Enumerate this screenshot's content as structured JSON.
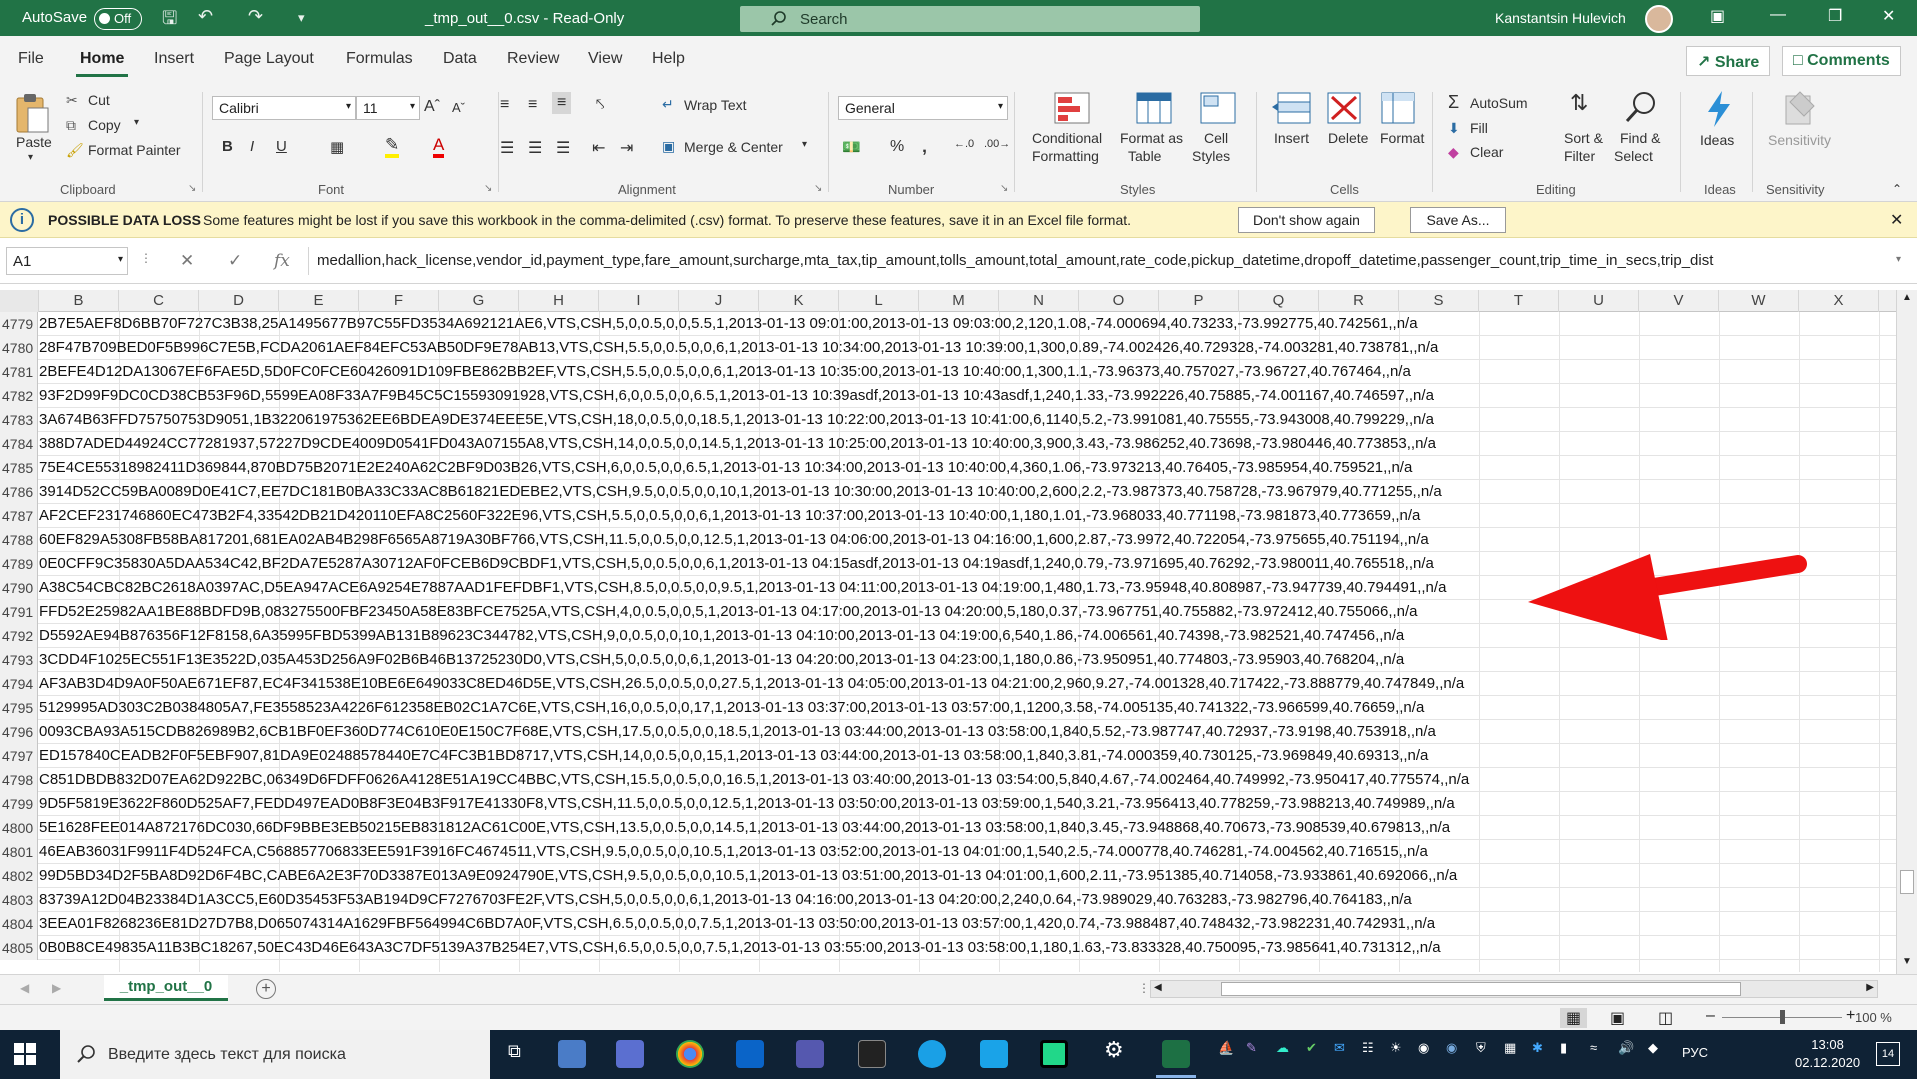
{
  "titlebar": {
    "autosave_label": "AutoSave",
    "autosave_state": "Off",
    "filename": "_tmp_out__0.csv  -  Read-Only",
    "search_placeholder": "Search",
    "user_name": "Kanstantsin Hulevich"
  },
  "ribbon_tabs": [
    "File",
    "Home",
    "Insert",
    "Page Layout",
    "Formulas",
    "Data",
    "Review",
    "View",
    "Help"
  ],
  "active_tab": "Home",
  "share_label": "Share",
  "comments_label": "Comments",
  "clipboard": {
    "paste": "Paste",
    "cut": "Cut",
    "copy": "Copy",
    "format_painter": "Format Painter",
    "group": "Clipboard"
  },
  "font": {
    "name": "Calibri",
    "size": "11",
    "group": "Font"
  },
  "alignment": {
    "wrap_text": "Wrap Text",
    "merge_center": "Merge & Center",
    "group": "Alignment"
  },
  "number": {
    "format": "General",
    "group": "Number"
  },
  "styles": {
    "conditional": "Conditional",
    "formatting": "Formatting",
    "format_as": "Format as",
    "table": "Table",
    "cell": "Cell",
    "cell_styles": "Styles",
    "group": "Styles"
  },
  "cells": {
    "insert": "Insert",
    "delete": "Delete",
    "format": "Format",
    "group": "Cells"
  },
  "editing": {
    "autosum": "AutoSum",
    "fill": "Fill",
    "clear": "Clear",
    "sort": "Sort &",
    "filter": "Filter",
    "find": "Find &",
    "select": "Select",
    "group": "Editing"
  },
  "ideas": {
    "label": "Ideas",
    "group": "Ideas"
  },
  "sensitivity": {
    "label": "Sensitivity",
    "group": "Sensitivity"
  },
  "infobar": {
    "title": "POSSIBLE DATA LOSS",
    "message": "Some features might be lost if you save this workbook in the comma-delimited (.csv) format. To preserve these features, save it in an Excel file format.",
    "dont_show": "Don't show again",
    "save_as": "Save As..."
  },
  "namebox": "A1",
  "formula": "medallion,hack_license,vendor_id,payment_type,fare_amount,surcharge,mta_tax,tip_amount,tolls_amount,total_amount,rate_code,pickup_datetime,dropoff_datetime,passenger_count,trip_time_in_secs,trip_dist",
  "columns": [
    "B",
    "C",
    "D",
    "E",
    "F",
    "G",
    "H",
    "I",
    "J",
    "K",
    "L",
    "M",
    "N",
    "O",
    "P",
    "Q",
    "R",
    "S",
    "T",
    "U",
    "V",
    "W",
    "X"
  ],
  "rows": [
    {
      "n": "4779",
      "text": "2B7E5AEF8D6BB70F727C3B38,25A1495677B97C55FD3534A692121AE6,VTS,CSH,5,0,0.5,0,0,5.5,1,2013-01-13 09:01:00,2013-01-13 09:03:00,2,120,1.08,-74.000694,40.73233,-73.992775,40.742561,,n/a"
    },
    {
      "n": "4780",
      "text": "28F47B709BED0F5B996C7E5B,FCDA2061AEF84EFC53AB50DF9E78AB13,VTS,CSH,5.5,0,0.5,0,0,6,1,2013-01-13 10:34:00,2013-01-13 10:39:00,1,300,0.89,-74.002426,40.729328,-74.003281,40.738781,,n/a"
    },
    {
      "n": "4781",
      "text": "2BEFE4D12DA13067EF6FAE5D,5D0FC0FCE60426091D109FBE862BB2EF,VTS,CSH,5.5,0,0.5,0,0,6,1,2013-01-13 10:35:00,2013-01-13 10:40:00,1,300,1.1,-73.96373,40.757027,-73.96727,40.767464,,n/a"
    },
    {
      "n": "4782",
      "text": "93F2D99F9DC0CD38CB53F96D,5599EA08F33A7F9B45C5C15593091928,VTS,CSH,6,0,0.5,0,0,6.5,1,2013-01-13 10:39asdf,2013-01-13 10:43asdf,1,240,1.33,-73.992226,40.75885,-74.001167,40.746597,,n/a"
    },
    {
      "n": "4783",
      "text": "3A674B63FFD75750753D9051,1B322061975362EE6BDEA9DE374EEE5E,VTS,CSH,18,0,0.5,0,0,18.5,1,2013-01-13 10:22:00,2013-01-13 10:41:00,6,1140,5.2,-73.991081,40.75555,-73.943008,40.799229,,n/a"
    },
    {
      "n": "4784",
      "text": "388D7ADED44924CC77281937,57227D9CDE4009D0541FD043A07155A8,VTS,CSH,14,0,0.5,0,0,14.5,1,2013-01-13 10:25:00,2013-01-13 10:40:00,3,900,3.43,-73.986252,40.73698,-73.980446,40.773853,,n/a"
    },
    {
      "n": "4785",
      "text": "75E4CE55318982411D369844,870BD75B2071E2E240A62C2BF9D03B26,VTS,CSH,6,0,0.5,0,0,6.5,1,2013-01-13 10:34:00,2013-01-13 10:40:00,4,360,1.06,-73.973213,40.76405,-73.985954,40.759521,,n/a"
    },
    {
      "n": "4786",
      "text": "3914D52CC59BA0089D0E41C7,EE7DC181B0BA33C33AC8B61821EDEBE2,VTS,CSH,9.5,0,0.5,0,0,10,1,2013-01-13 10:30:00,2013-01-13 10:40:00,2,600,2.2,-73.987373,40.758728,-73.967979,40.771255,,n/a"
    },
    {
      "n": "4787",
      "text": "AF2CEF231746860EC473B2F4,33542DB21D420110EFA8C2560F322E96,VTS,CSH,5.5,0,0.5,0,0,6,1,2013-01-13 10:37:00,2013-01-13 10:40:00,1,180,1.01,-73.968033,40.771198,-73.981873,40.773659,,n/a"
    },
    {
      "n": "4788",
      "text": "60EF829A5308FB58BA817201,681EA02AB4B298F6565A8719A30BF766,VTS,CSH,11.5,0,0.5,0,0,12.5,1,2013-01-13 04:06:00,2013-01-13 04:16:00,1,600,2.87,-73.9972,40.722054,-73.975655,40.751194,,n/a"
    },
    {
      "n": "4789",
      "text": "0E0CFF9C35830A5DAA534C42,BF2DA7E5287A30712AF0FCEB6D9CBDF1,VTS,CSH,5,0,0.5,0,0,6,1,2013-01-13 04:15asdf,2013-01-13 04:19asdf,1,240,0.79,-73.971695,40.76292,-73.980011,40.765518,,n/a"
    },
    {
      "n": "4790",
      "text": "A38C54CBC82BC2618A0397AC,D5EA947ACE6A9254E7887AAD1FEFDBF1,VTS,CSH,8.5,0,0.5,0,0,9.5,1,2013-01-13 04:11:00,2013-01-13 04:19:00,1,480,1.73,-73.95948,40.808987,-73.947739,40.794491,,n/a"
    },
    {
      "n": "4791",
      "text": "FFD52E25982AA1BE88BDFD9B,083275500FBF23450A58E83BFCE7525A,VTS,CSH,4,0,0.5,0,0,5,1,2013-01-13 04:17:00,2013-01-13 04:20:00,5,180,0.37,-73.967751,40.755882,-73.972412,40.755066,,n/a"
    },
    {
      "n": "4792",
      "text": "D5592AE94B876356F12F8158,6A35995FBD5399AB131B89623C344782,VTS,CSH,9,0,0.5,0,0,10,1,2013-01-13 04:10:00,2013-01-13 04:19:00,6,540,1.86,-74.006561,40.74398,-73.982521,40.747456,,n/a"
    },
    {
      "n": "4793",
      "text": "3CDD4F1025EC551F13E3522D,035A453D256A9F02B6B46B13725230D0,VTS,CSH,5,0,0.5,0,0,6,1,2013-01-13 04:20:00,2013-01-13 04:23:00,1,180,0.86,-73.950951,40.774803,-73.95903,40.768204,,n/a"
    },
    {
      "n": "4794",
      "text": "AF3AB3D4D9A0F50AE671EF87,EC4F341538E10BE6E649033C8ED46D5E,VTS,CSH,26.5,0,0.5,0,0,27.5,1,2013-01-13 04:05:00,2013-01-13 04:21:00,2,960,9.27,-74.001328,40.717422,-73.888779,40.747849,,n/a"
    },
    {
      "n": "4795",
      "text": "5129995AD303C2B0384805A7,FE3558523A4226F612358EB02C1A7C6E,VTS,CSH,16,0,0.5,0,0,17,1,2013-01-13 03:37:00,2013-01-13 03:57:00,1,1200,3.58,-74.005135,40.741322,-73.966599,40.76659,,n/a"
    },
    {
      "n": "4796",
      "text": "0093CBA93A515CDB826989B2,6CB1BF0EF360D774C610E0E150C7F68E,VTS,CSH,17.5,0,0.5,0,0,18.5,1,2013-01-13 03:44:00,2013-01-13 03:58:00,1,840,5.52,-73.987747,40.72937,-73.9198,40.753918,,n/a"
    },
    {
      "n": "4797",
      "text": "ED157840CEADB2F0F5EBF907,81DA9E02488578440E7C4FC3B1BD8717,VTS,CSH,14,0,0.5,0,0,15,1,2013-01-13 03:44:00,2013-01-13 03:58:00,1,840,3.81,-74.000359,40.730125,-73.969849,40.69313,,n/a"
    },
    {
      "n": "4798",
      "text": "C851DBDB832D07EA62D922BC,06349D6FDFF0626A4128E51A19CC4BBC,VTS,CSH,15.5,0,0.5,0,0,16.5,1,2013-01-13 03:40:00,2013-01-13 03:54:00,5,840,4.67,-74.002464,40.749992,-73.950417,40.775574,,n/a"
    },
    {
      "n": "4799",
      "text": "9D5F5819E3622F860D525AF7,FEDD497EAD0B8F3E04B3F917E41330F8,VTS,CSH,11.5,0,0.5,0,0,12.5,1,2013-01-13 03:50:00,2013-01-13 03:59:00,1,540,3.21,-73.956413,40.778259,-73.988213,40.749989,,n/a"
    },
    {
      "n": "4800",
      "text": "5E1628FEE014A872176DC030,66DF9BBE3EB50215EB831812AC61C00E,VTS,CSH,13.5,0,0.5,0,0,14.5,1,2013-01-13 03:44:00,2013-01-13 03:58:00,1,840,3.45,-73.948868,40.70673,-73.908539,40.679813,,n/a"
    },
    {
      "n": "4801",
      "text": "46EAB36031F9911F4D524FCA,C568857706833EE591F3916FC4674511,VTS,CSH,9.5,0,0.5,0,0,10.5,1,2013-01-13 03:52:00,2013-01-13 04:01:00,1,540,2.5,-74.000778,40.746281,-74.004562,40.716515,,n/a"
    },
    {
      "n": "4802",
      "text": "99D5BD34D2F5BA8D92D6F4BC,CABE6A2E3F70D3387E013A9E0924790E,VTS,CSH,9.5,0,0.5,0,0,10.5,1,2013-01-13 03:51:00,2013-01-13 04:01:00,1,600,2.11,-73.951385,40.714058,-73.933861,40.692066,,n/a"
    },
    {
      "n": "4803",
      "text": "83739A12D04B23384D1A3CC5,E60D35453F53AB194D9CF7276703FE2F,VTS,CSH,5,0,0.5,0,0,6,1,2013-01-13 04:16:00,2013-01-13 04:20:00,2,240,0.64,-73.989029,40.763283,-73.982796,40.764183,,n/a"
    },
    {
      "n": "4804",
      "text": "3EEA01F8268236E81D27D7B8,D065074314A1629FBF564994C6BD7A0F,VTS,CSH,6.5,0,0.5,0,0,7.5,1,2013-01-13 03:50:00,2013-01-13 03:57:00,1,420,0.74,-73.988487,40.748432,-73.982231,40.742931,,n/a"
    },
    {
      "n": "4805",
      "text": "0B0B8CE49835A11B3BC18267,50EC43D46E643A3C7DF5139A37B254E7,VTS,CSH,6.5,0,0.5,0,0,7.5,1,2013-01-13 03:55:00,2013-01-13 03:58:00,1,180,1.63,-73.833328,40.750095,-73.985641,40.731312,,n/a"
    }
  ],
  "sheet_tab": "_tmp_out__0",
  "zoom": "100 %",
  "taskbar": {
    "search_placeholder": "Введите здесь текст для поиска",
    "lang": "РУС",
    "time": "13:08",
    "date": "02.12.2020",
    "notifications": "14"
  },
  "colors": {
    "excel_green": "#217346",
    "arrow_red": "#ee1111"
  }
}
